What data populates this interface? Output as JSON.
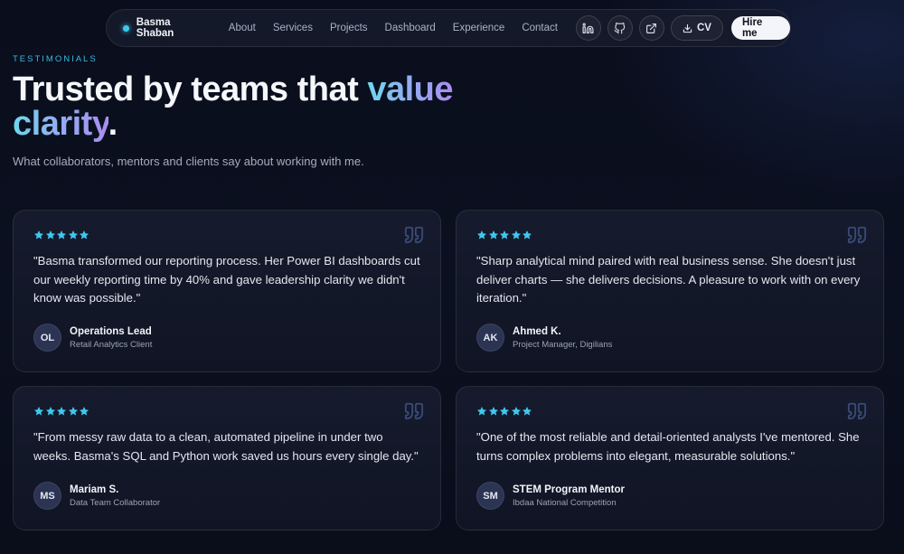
{
  "nav": {
    "brand": "Basma Shaban",
    "links": [
      "About",
      "Services",
      "Projects",
      "Dashboard",
      "Experience",
      "Contact"
    ],
    "cv_label": "CV",
    "hire_label": "Hire me"
  },
  "hero": {
    "eyebrow": "TESTIMONIALS",
    "headline_plain": "Trusted by teams that ",
    "headline_accent_1": "value",
    "headline_accent_2": "clarity",
    "headline_period": ".",
    "subtitle": "What collaborators, mentors and clients say about working with me."
  },
  "testimonials": [
    {
      "rating": 5,
      "quote": "\"Basma transformed our reporting process. Her Power BI dashboards cut our weekly reporting time by 40% and gave leadership clarity we didn't know was possible.\"",
      "initials": "OL",
      "name": "Operations Lead",
      "role": "Retail Analytics Client"
    },
    {
      "rating": 5,
      "quote": "\"Sharp analytical mind paired with real business sense. She doesn't just deliver charts — she delivers decisions. A pleasure to work with on every iteration.\"",
      "initials": "AK",
      "name": "Ahmed K.",
      "role": "Project Manager, Digilians"
    },
    {
      "rating": 5,
      "quote": "\"From messy raw data to a clean, automated pipeline in under two weeks. Basma's SQL and Python work saved us hours every single day.\"",
      "initials": "MS",
      "name": "Mariam S.",
      "role": "Data Team Collaborator"
    },
    {
      "rating": 5,
      "quote": "\"One of the most reliable and detail-oriented analysts I've mentored. She turns complex problems into elegant, measurable solutions.\"",
      "initials": "SM",
      "name": "STEM Program Mentor",
      "role": "Ibdaa National Competition"
    }
  ],
  "colors": {
    "accent": "#39b9e4",
    "star": "#3ec8f0",
    "background": "#0b1020"
  },
  "icons": [
    "linkedin-icon",
    "github-icon",
    "external-link-icon",
    "download-icon",
    "star-icon",
    "quote-icon"
  ]
}
